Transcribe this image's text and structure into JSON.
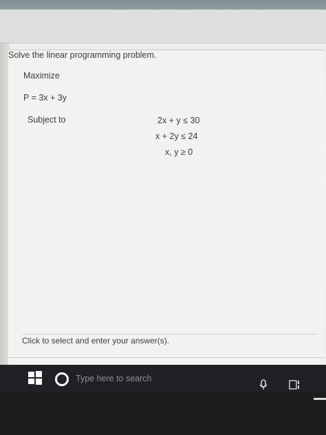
{
  "problem": {
    "prompt": "Solve the linear programming problem.",
    "objective_label": "Maximize",
    "objective": "P = 3x + 3y",
    "subject_to_label": "Subject to",
    "constraints": [
      "2x + y ≤ 30",
      "x + 2y ≤ 24",
      "x, y ≥ 0"
    ]
  },
  "answer": {
    "instruction": "Click to select and enter your answer(s)."
  },
  "taskbar": {
    "search_placeholder": "Type here to search"
  },
  "icons": {
    "start": "windows-logo-icon",
    "cortana": "circle-icon",
    "microphone": "microphone-icon",
    "task_view": "task-view-icon"
  }
}
